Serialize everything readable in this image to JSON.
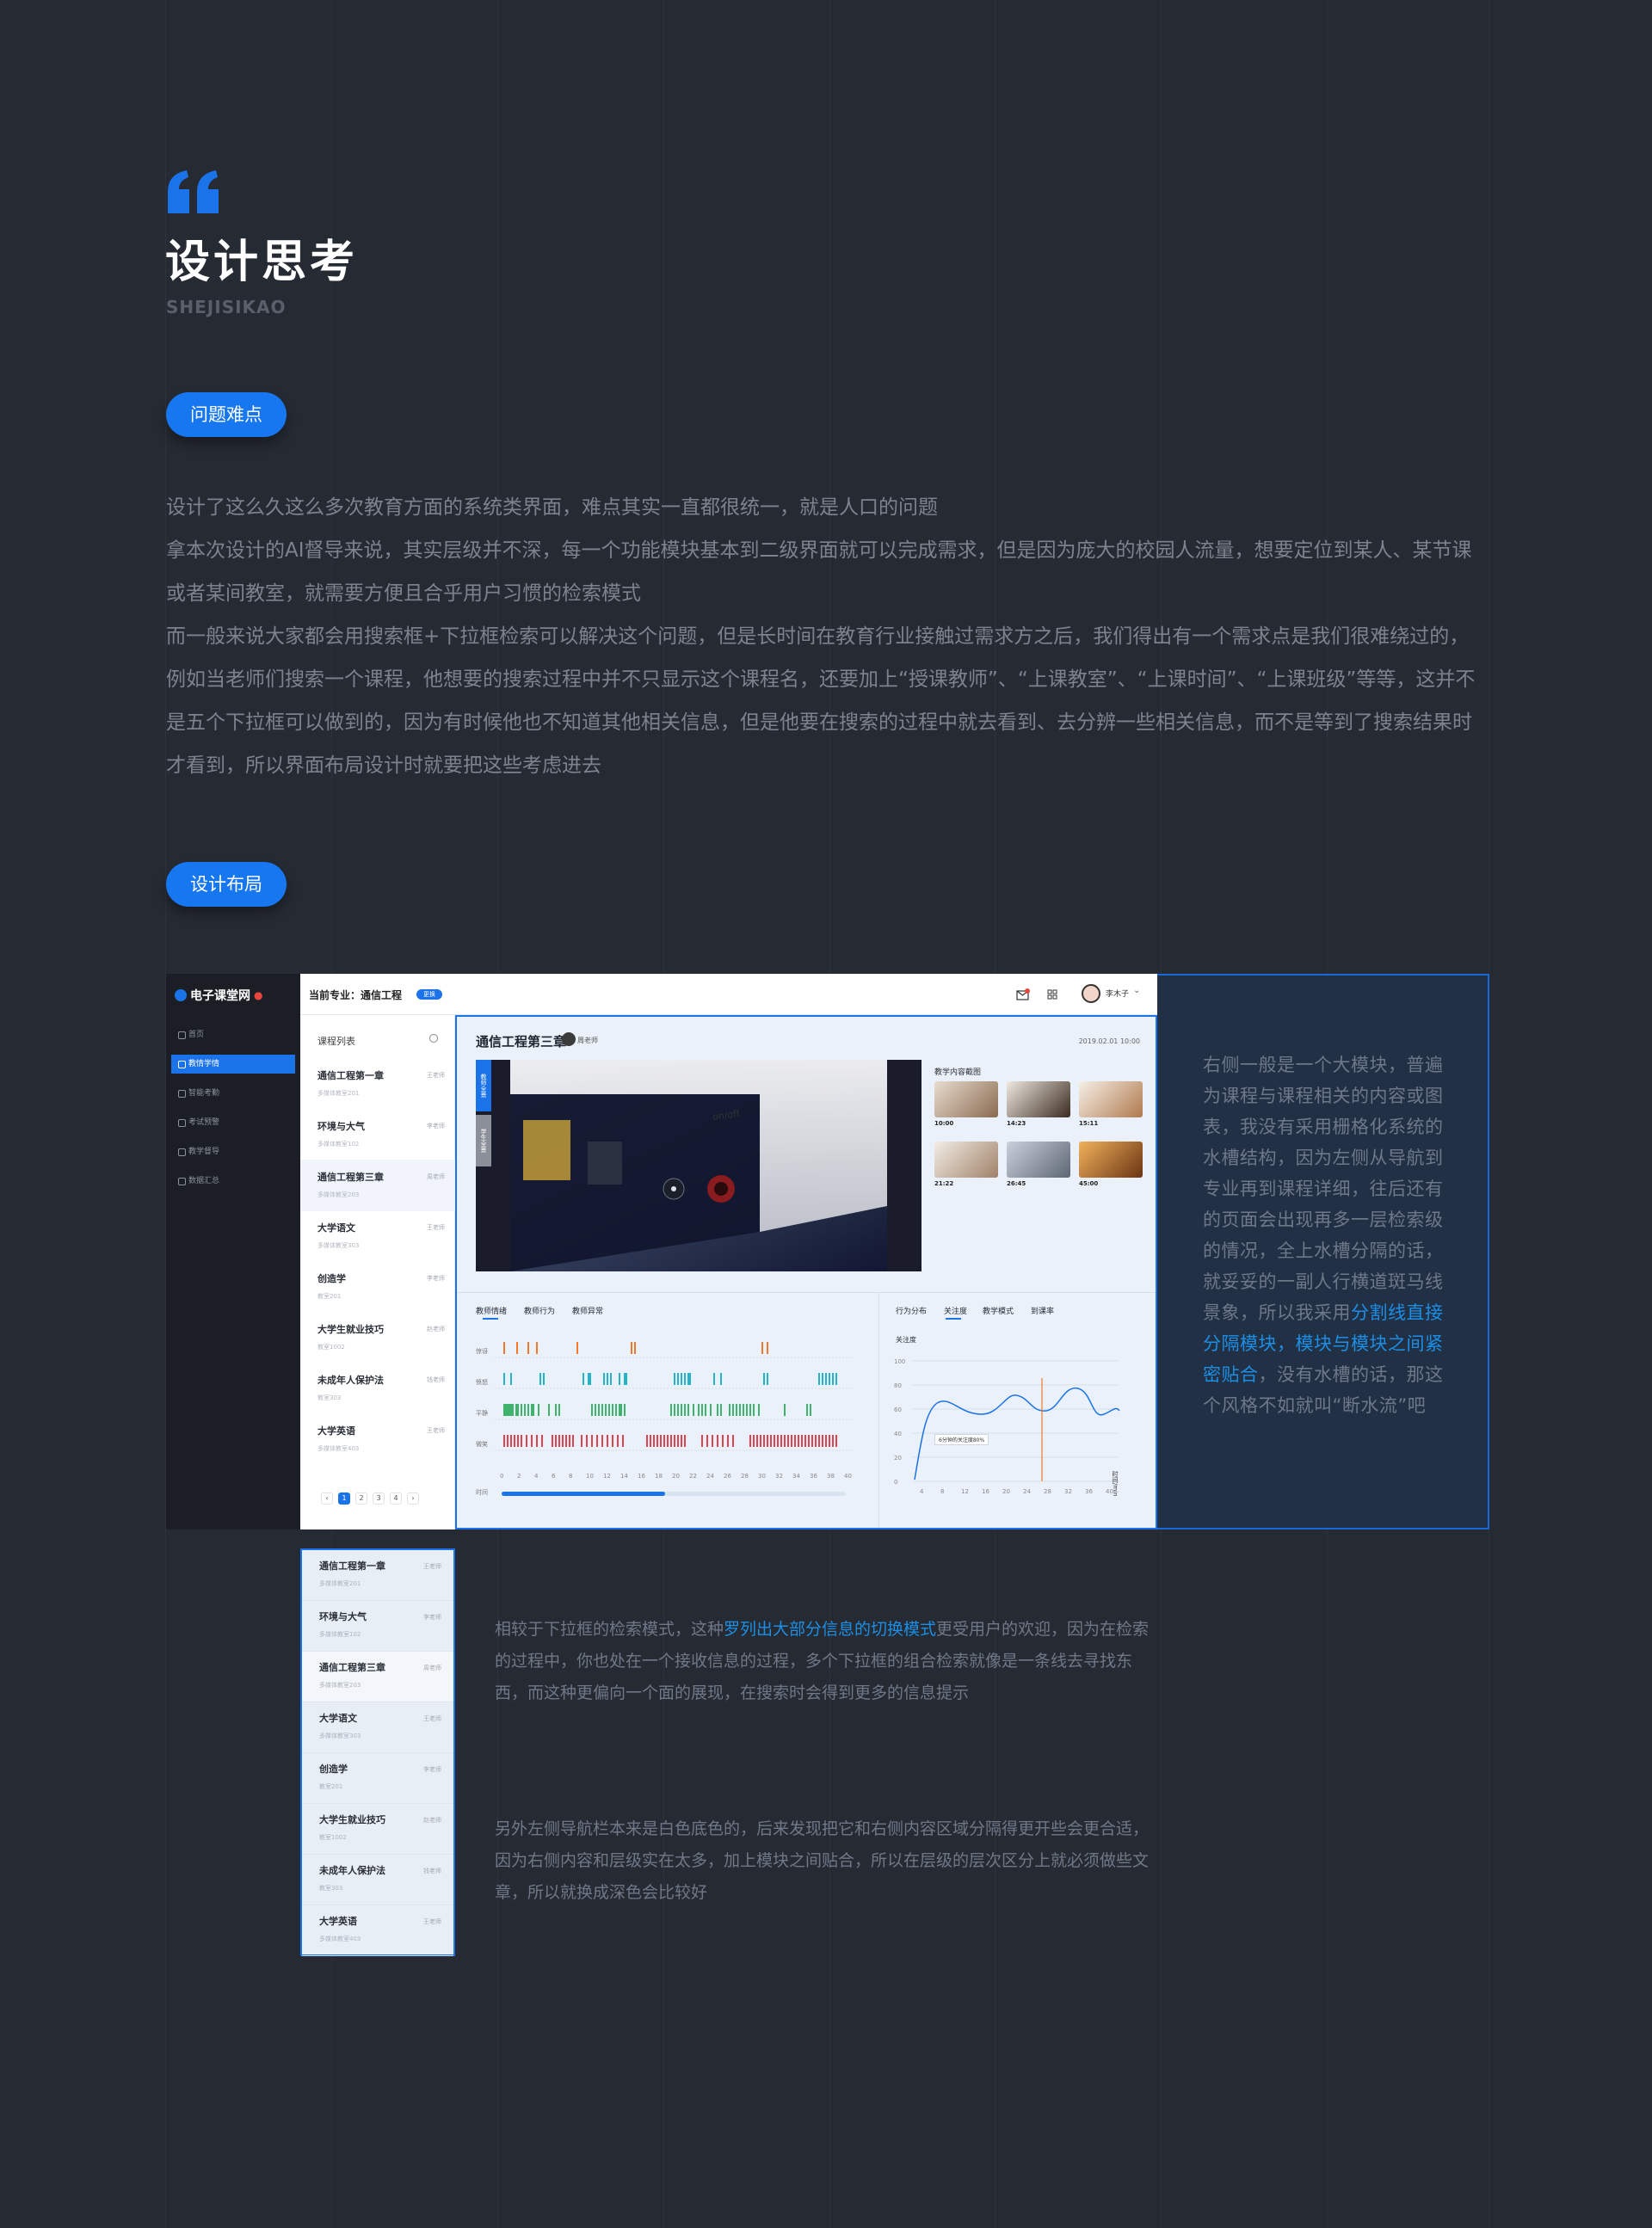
{
  "header": {
    "title": "设计思考",
    "subtitle": "SHEJISIKAO"
  },
  "section1": {
    "pill": "问题难点",
    "paragraphs": [
      "设计了这么久这么多次教育方面的系统类界面，难点其实一直都很统一，就是人口的问题",
      "拿本次设计的AI督导来说，其实层级并不深，每一个功能模块基本到二级界面就可以完成需求，但是因为庞大的校园人流量，想要定位到某人、某节课或者某间教室，就需要方便且合乎用户习惯的检索模式",
      "而一般来说大家都会用搜索框+下拉框检索可以解决这个问题，但是长时间在教育行业接触过需求方之后，我们得出有一个需求点是我们很难绕过的，例如当老师们搜索一个课程，他想要的搜索过程中并不只显示这个课程名，还要加上“授课教师”、“上课教室”、“上课时间”、“上课班级”等等，这并不是五个下拉框可以做到的，因为有时候他也不知道其他相关信息，但是他要在搜索的过程中就去看到、去分辨一些相关信息，而不是等到了搜索结果时才看到，所以界面布局设计时就要把这些考虑进去"
    ]
  },
  "section2": {
    "pill": "设计布局"
  },
  "app": {
    "logo": "电子课堂网",
    "nav": [
      "首页",
      "教情学情",
      "智能考勤",
      "考试预警",
      "教学督导",
      "数据汇总"
    ],
    "current_major": "当前专业：通信工程",
    "major_tag": "更换",
    "user": "李木子",
    "list_title": "课程列表",
    "courses": [
      {
        "name": "通信工程第一章",
        "room": "多媒体教室201",
        "teacher": "王老师"
      },
      {
        "name": "环境与大气",
        "room": "多媒体教室102",
        "teacher": "李老师"
      },
      {
        "name": "通信工程第三章",
        "room": "多媒体教室203",
        "teacher": "周老师"
      },
      {
        "name": "大学语文",
        "room": "多媒体教室303",
        "teacher": "王老师"
      },
      {
        "name": "创造学",
        "room": "教室201",
        "teacher": "李老师"
      },
      {
        "name": "大学生就业技巧",
        "room": "教室1002",
        "teacher": "赵老师"
      },
      {
        "name": "未成年人保护法",
        "room": "教室303",
        "teacher": "钱老师"
      },
      {
        "name": "大学英语",
        "room": "多媒体教室403",
        "teacher": "王老师"
      }
    ],
    "pages": [
      "1",
      "2",
      "3",
      "4"
    ],
    "content_title": "通信工程第三章",
    "teacher": "周老师",
    "date": "2019.02.01  10:00",
    "video_tabs": [
      "教师全景",
      "学生全景"
    ],
    "video_label": "on/off",
    "gallery_title": "教学内容截图",
    "gallery_times": [
      "10:00",
      "14:23",
      "15:11",
      "21:22",
      "26:45",
      "45:00"
    ],
    "left_tabs": [
      "教师情绪",
      "教师行为",
      "教师异常"
    ],
    "row_labels": [
      "惊讶",
      "愤怒",
      "平静",
      "微笑"
    ],
    "x_ticks": [
      "0",
      "2",
      "4",
      "6",
      "8",
      "10",
      "12",
      "14",
      "16",
      "18",
      "20",
      "22",
      "24",
      "26",
      "28",
      "30",
      "32",
      "34",
      "36",
      "38",
      "40"
    ],
    "timeline_label": "时间",
    "right_tabs": [
      "行为分布",
      "关注度",
      "教学模式",
      "到课率"
    ],
    "chart_title": "关注度",
    "chart_y_ticks": [
      "100",
      "80",
      "60",
      "40",
      "20",
      "0"
    ],
    "chart_x_ticks": [
      "4",
      "8",
      "12",
      "16",
      "20",
      "24",
      "28",
      "32",
      "36",
      "40"
    ],
    "chart_tooltip": "6分钟的关注度80%",
    "chart_unit": "时间/min"
  },
  "right_text": {
    "before": "右侧一般是一个大模块，普遍为课程与课程相关的内容或图表，我没有采用栅格化系统的水槽结构，因为左侧从导航到专业再到课程详细，往后还有的页面会出现再多一层检索级的情况，全上水槽分隔的话，就妥妥的一副人行横道斑马线景象，所以我采用",
    "highlight": "分割线直接分隔模块，模块与模块之间紧密贴合",
    "after": "，没有水槽的话，那这个风格不如就叫“断水流”吧"
  },
  "para1": {
    "before": "相较于下拉框的检索模式，这种",
    "highlight": "罗列出大部分信息的切换模式",
    "after": "更受用户的欢迎，因为在检索的过程中，你也处在一个接收信息的过程，多个下拉框的组合检索就像是一条线去寻找东西，而这种更偏向一个面的展现，在搜索时会得到更多的信息提示"
  },
  "para2": "另外左侧导航栏本来是白色底色的，后来发现把它和右侧内容区域分隔得更开些会更合适，因为右侧内容和层级实在太多，加上模块之间贴合，所以在层级的层次区分上就必须做些文章，所以就换成深色会比较好",
  "colors": {
    "background": "#262a33",
    "accent": "#1677f0",
    "highlight": "#1b8fe6",
    "surprise": "#f07a2c",
    "anger": "#22b5c9",
    "calm": "#3db36b",
    "smile": "#e0434f"
  }
}
